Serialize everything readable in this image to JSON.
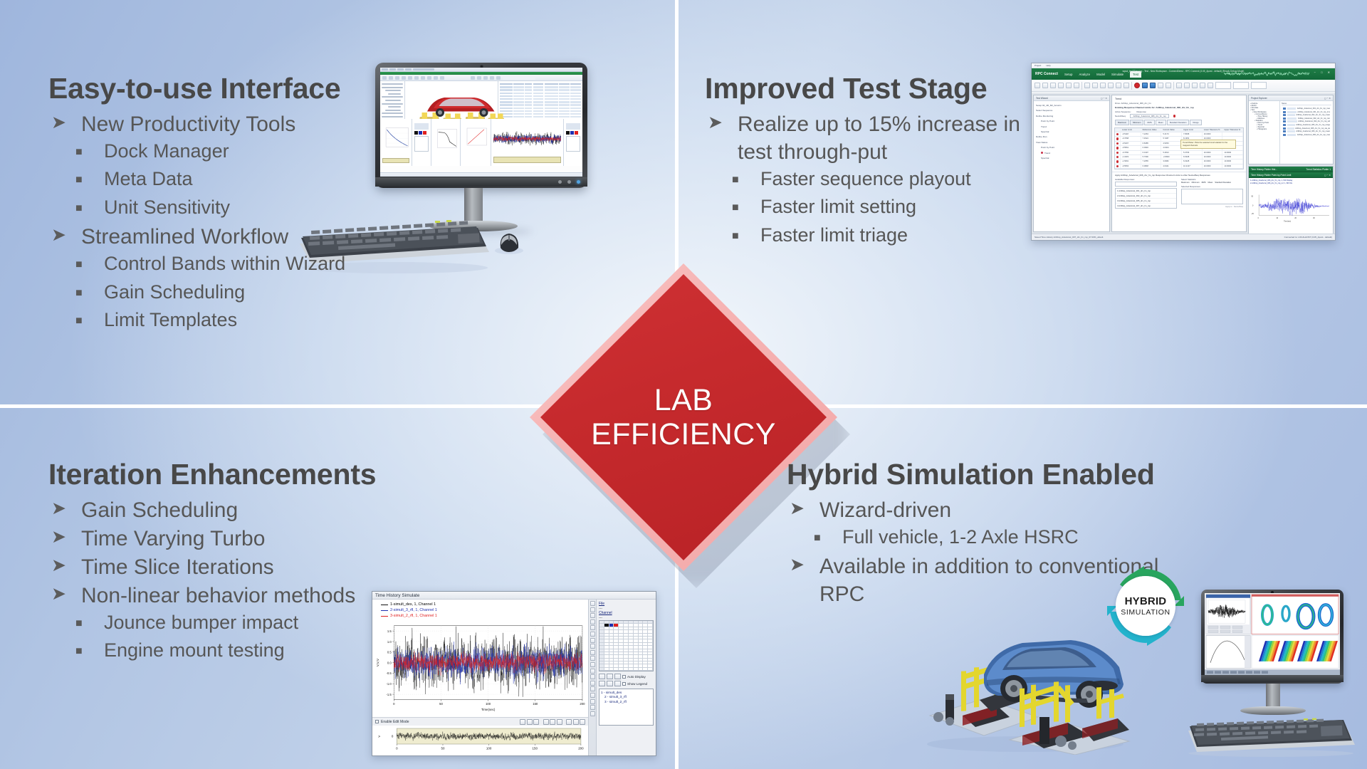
{
  "slide": {
    "center_badge": {
      "line1": "LAB",
      "line2": "EFFICIENCY",
      "color": "#c62a2d"
    },
    "background_color": "#b0c4e3",
    "divider_color": "#ffffff"
  },
  "quadrants": {
    "top_left": {
      "title": "Easy-to-use Interface",
      "bullets": [
        {
          "level": 1,
          "text": "New Productivity Tools"
        },
        {
          "level": 2,
          "text": "Dock Manager"
        },
        {
          "level": 2,
          "text": "Meta Data"
        },
        {
          "level": 2,
          "text": "Unit Sensitivity"
        },
        {
          "level": 1,
          "text": "Streamlined Workflow"
        },
        {
          "level": 2,
          "text": "Control Bands within Wizard"
        },
        {
          "level": 2,
          "text": "Gain Scheduling"
        },
        {
          "level": 2,
          "text": "Limit Templates"
        }
      ]
    },
    "top_right": {
      "title": "Improved Test Stage",
      "bullets": [
        {
          "level": 1,
          "text": "Realize up to 15% increase in test through-put"
        },
        {
          "level": 2,
          "text": "Faster sequence playout"
        },
        {
          "level": 2,
          "text": "Faster limit setting"
        },
        {
          "level": 2,
          "text": "Faster limit triage"
        }
      ]
    },
    "bottom_left": {
      "title": "Iteration Enhancements",
      "bullets": [
        {
          "level": 1,
          "text": "Gain Scheduling"
        },
        {
          "level": 1,
          "text": "Time Varying Turbo"
        },
        {
          "level": 1,
          "text": "Time Slice Iterations"
        },
        {
          "level": 1,
          "text": "Non-linear behavior methods"
        },
        {
          "level": 2,
          "text": "Jounce bumper impact"
        },
        {
          "level": 2,
          "text": "Engine mount testing"
        }
      ]
    },
    "bottom_right": {
      "title": "Hybrid Simulation Enabled",
      "bullets": [
        {
          "level": 1,
          "text": "Wizard-driven"
        },
        {
          "level": 2,
          "text": "Full vehicle, 1-2 Axle HSRC"
        },
        {
          "level": 1,
          "text": "Available in addition to conventional RPC"
        }
      ]
    }
  },
  "hybrid_badge": {
    "line1": "HYBRID",
    "line2": "SIMULATION",
    "arrow_top_color": "#28a55e",
    "arrow_bottom_color": "#23b3cc"
  },
  "time_history_window": {
    "title": "Time History Simulate",
    "legend": [
      {
        "label": "1-simult_des, 1, Channel 1",
        "color": "#111111"
      },
      {
        "label": "2-simult_3_rfl, 1, Channel 1",
        "color": "#1e2fb0"
      },
      {
        "label": "3-simult_2_rfl, 1, Channel 1",
        "color": "#e02020"
      }
    ],
    "side_panel": {
      "file_label": "File",
      "channel_label": "Channel",
      "auto_display": "Auto Display",
      "show_legend": "Show Legend",
      "channels": [
        "1 - simult_des",
        "2 - simult_3_rfl",
        "3 - simult_2_rfl"
      ]
    },
    "edit_bar": {
      "checkbox_label": "Enable Edit Mode"
    },
    "chart_data": {
      "type": "line",
      "title": "Time History Simulate",
      "xlabel": "Time(sec)",
      "ylabel": "V,V,V",
      "xlim": [
        0,
        200
      ],
      "ylim": [
        -1.75,
        1.75
      ],
      "xticks": [
        0,
        50,
        100,
        150,
        200
      ],
      "yticks": [
        -1.5,
        -1.0,
        -0.5,
        0.0,
        0.5,
        1.0,
        1.5
      ],
      "grid": true,
      "legend_position": "top-left",
      "series": [
        {
          "name": "1-simult_des, 1, Channel 1",
          "color": "#111111",
          "amplitude": 1.35,
          "description": "broadband random, widest envelope"
        },
        {
          "name": "2-simult_3_rfl, 1, Channel 1",
          "color": "#1e2fb0",
          "amplitude": 0.8,
          "description": "broadband random, mid envelope"
        },
        {
          "name": "3-simult_2_rfl, 1, Channel 1",
          "color": "#e02020",
          "amplitude": 0.45,
          "description": "broadband random, narrow envelope"
        }
      ],
      "overview_strip": {
        "xlim": [
          0,
          200
        ],
        "xticks": [
          0,
          50,
          100,
          150,
          200
        ],
        "ytick": 0
      }
    }
  },
  "rpc_connect_window": {
    "menu": [
      "Project",
      "Help"
    ],
    "brand": "RPC Connect",
    "tabs": [
      "Setup",
      "Analyze",
      "Model",
      "Simulate",
      "Test"
    ],
    "selected_tab": "Test",
    "title_bar": "sqsol_test/Planning - Test - New Workspace - ConnectDemo - RPC Connect (3.05_Apost - default) (Ready Debug Mode)",
    "left_panel": {
      "header": "Test Wizard",
      "items": [
        "Setup 02_4D_6R_Accelm",
        "Select Sequence",
        "Define Monitoring",
        "Point by Point",
        "Trend",
        "Spectral",
        "Define Run",
        "View Status",
        "Point by Point",
        "Trend",
        "Spectral"
      ]
    },
    "center_panel": {
      "heading": "Trend",
      "subheading": "Drive: ArtDisp_AxleAccel_006_drv_fm",
      "section": "Existing Response Channel Limits for: ArtDisp_AxleAccel_006_drv_fm_rsp",
      "field_labels": [
        "Active Sequence:",
        "Response:",
        "NextoSSeq:"
      ],
      "field_value": "ArtDisp_AxleAccel_006_drv_fm_rsp",
      "tabs": [
        "Maximum",
        "Minimum",
        "RMS",
        "Mean",
        "Standard Deviation",
        "Range"
      ],
      "table_group_header": "Absoll",
      "table_headers": [
        "Lower Limit",
        "Reference Value",
        "Current Value",
        "Upper Limit",
        "Lower Tolerance %",
        "Upper Tolerance %"
      ],
      "table_rows": [
        [
          "-0.5118",
          "7.2263",
          "5.4173",
          "7.8068",
          "10.0000",
          ""
        ],
        [
          "-0.7058",
          "7.4524",
          "5.7287",
          "8.1954",
          "10.0000",
          ""
        ],
        [
          "-0.5407",
          "6.8485",
          "4.5253",
          "6.9534",
          "10.0000",
          ""
        ],
        [
          "-0.5561",
          "6.0946",
          "4.6404",
          "10.2130",
          "10.0000",
          "10.0000"
        ],
        [
          "-0.7050",
          "6.0197",
          "5.2813",
          "5.3766",
          "10.0000",
          "10.0000"
        ],
        [
          "-1.1823",
          "5.7690",
          "-2.8900",
          "6.5408",
          "10.0000",
          "10.0000"
        ],
        [
          "-1.5691",
          "7.2655",
          "3.6082",
          "6.0228",
          "10.0000",
          "10.0000"
        ],
        [
          "-0.5563",
          "6.0848",
          "4.6421",
          "10.2137",
          "10.0000",
          "10.0000"
        ]
      ],
      "tooltip": "Trend Plotter: Plots the selected trend statistic for the mapped channels",
      "apply_heading": "Apply ArtDisp_AxleAccel_006_drv_fm_rsp Response Channel Limits to other NextedSeq Responses",
      "available_label": "Available Responses:",
      "available_items": [
        "1  ArtDisp_AxleAccel_001_drv_fm_rsp",
        "2  ArtDisp_AxleAccel_002_drv_fm_rsp",
        "3  ArtDisp_AxleAccel_005_drv_fm_rsp",
        "4  ArtDisp_AxleAccel_007_drv_fm_rsp"
      ],
      "select_statistics_label": "Select Statistics",
      "statistics": [
        "Maximum",
        "Minimum",
        "RMS",
        "Mean",
        "Standard Deviation"
      ],
      "selected_responses_label": "Selected Responses:",
      "apply_button": "Apply to",
      "apply_button2": "NextedSeq"
    },
    "right_panel": {
      "header": "Project Explorer",
      "filter_label": "Trend",
      "column_header": "Name",
      "rows": [
        "ArtDisp_AxleAccel_001_drv_fm_rsp_max",
        "ArtDisp_AxleAccel_001_drv_fm_rsp_rms",
        "ArtDisp_AxleAccel_002_drv_fm_rsp_mean",
        "ArtDisp_AxleAccel_002_drv_fm_rsp_min",
        "ArtDisp_AxleAccel_002_drv_fm_rsp_std",
        "ArtDisp_AxleAccel_005_drv_fm_rsp_range",
        "ArtDisp_AxleAccel_005_drv_fm_rsp_sta_de",
        "ArtDisp_AxleAccel_006_drv_fm_rsp_mean",
        "ArtDisp_AxleAccel_006_drv_fm_rsp_max"
      ],
      "tree": [
        "Analyze",
        "Model",
        "Simulate",
        "Test",
        "New Workspace",
        "ConnectDemo",
        "Time History",
        "Matrices",
        "Statistics",
        "Point by Point",
        "Trend",
        "Spectral",
        "Histograms"
      ]
    },
    "plot_tabs": [
      "Time History Plotter Hist...",
      "Trend Statistics Plotter 1",
      "Time History Plotter 1",
      "Kdaho Plotter 1"
    ],
    "plot_title": "Time History Plotter Point-by-Point Limit",
    "plot_legend": [
      "1-ArtDisp_AxleAccel_006_drv_fm_rsp, 1, INF Display",
      "2-ArtDisp_AxleAccel_006_drv_fm_rsp_ref, 1, INF Dis"
    ],
    "plot_axes": {
      "xlabel": "Time(sec)",
      "xticks": [
        0,
        10,
        20,
        30
      ],
      "yticks": [
        -25,
        0,
        50
      ]
    },
    "status_left": "Saved Time History ArtDisp_AxleAccel_007_drv_fm_rsp_07.09%_absolt.",
    "status_right": "Connected to: LOCALHOST  (3.05_Apost - default)"
  }
}
